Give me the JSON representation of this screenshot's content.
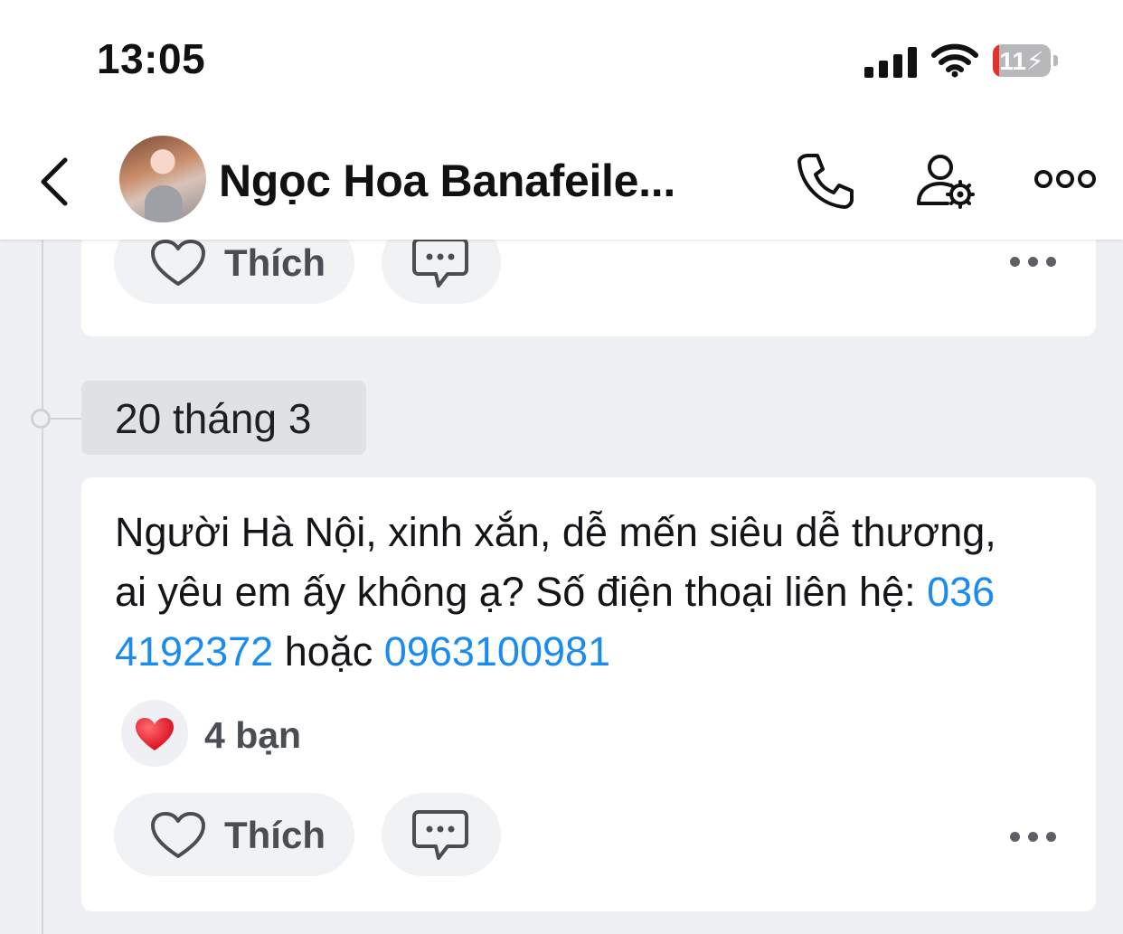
{
  "status_bar": {
    "time": "13:05",
    "battery": "11",
    "battery_level": 0.11
  },
  "header": {
    "title": "Ngọc Hoa Banafeile..."
  },
  "feed": {
    "post1": {
      "like_label": "Thích"
    },
    "date_label": "20 tháng 3",
    "post2": {
      "line1": "Người Hà Nội, xinh xắn, dễ mến siêu dễ thương,",
      "line2_text": "ai yêu em ấy không ạ? Số điện thoại liên hệ: ",
      "phone1_part1": "036",
      "phone1_part2": "4192372",
      "connector": " hoặc ",
      "phone2": "0963100981",
      "reaction_count": "4 bạn",
      "like_label": "Thích"
    }
  },
  "colors": {
    "link": "#1a8cf0",
    "battery_low": "#e5302b",
    "heart": "#e8232f"
  },
  "icons": [
    "signal-icon",
    "wifi-icon",
    "battery-icon",
    "back-chevron-icon",
    "phone-icon",
    "user-settings-icon",
    "more-options-icon",
    "heart-outline-icon",
    "comment-icon",
    "more-dots-icon",
    "heart-reaction-icon"
  ]
}
